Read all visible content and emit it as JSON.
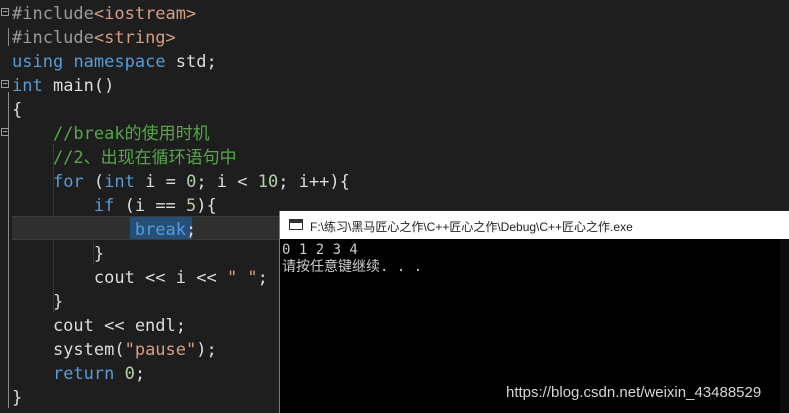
{
  "editor": {
    "lines": [
      [
        {
          "t": "#include",
          "c": "#9b9b9b"
        },
        {
          "t": "<iostream>",
          "c": "#d69d85"
        }
      ],
      [
        {
          "t": "#include",
          "c": "#9b9b9b"
        },
        {
          "t": "<string>",
          "c": "#d69d85"
        }
      ],
      [
        {
          "t": "using",
          "c": "#569cd6"
        },
        {
          "t": " ",
          "c": "#dcdcdc"
        },
        {
          "t": "namespace",
          "c": "#569cd6"
        },
        {
          "t": " std;",
          "c": "#dcdcdc"
        }
      ],
      [
        {
          "t": "int",
          "c": "#569cd6"
        },
        {
          "t": " main()",
          "c": "#dcdcdc"
        }
      ],
      [
        {
          "t": "{",
          "c": "#dcdcdc"
        }
      ],
      [
        {
          "t": "    //break的使用时机",
          "c": "#57a64a"
        }
      ],
      [
        {
          "t": "    //2、出现在循环语句中",
          "c": "#57a64a"
        }
      ],
      [
        {
          "t": "    ",
          "c": "#dcdcdc"
        },
        {
          "t": "for",
          "c": "#569cd6"
        },
        {
          "t": " (",
          "c": "#dcdcdc"
        },
        {
          "t": "int",
          "c": "#569cd6"
        },
        {
          "t": " i = ",
          "c": "#dcdcdc"
        },
        {
          "t": "0",
          "c": "#b5cea8"
        },
        {
          "t": "; i < ",
          "c": "#dcdcdc"
        },
        {
          "t": "10",
          "c": "#b5cea8"
        },
        {
          "t": "; i++){",
          "c": "#dcdcdc"
        }
      ],
      [
        {
          "t": "        ",
          "c": "#dcdcdc"
        },
        {
          "t": "if",
          "c": "#569cd6"
        },
        {
          "t": " (i == ",
          "c": "#dcdcdc"
        },
        {
          "t": "5",
          "c": "#b5cea8"
        },
        {
          "t": "){",
          "c": "#dcdcdc"
        }
      ],
      [
        {
          "t": "            ",
          "c": "#dcdcdc"
        },
        {
          "t": "break",
          "c": "#569cd6"
        },
        {
          "t": ";",
          "c": "#dcdcdc"
        }
      ],
      [
        {
          "t": "        }",
          "c": "#dcdcdc"
        }
      ],
      [
        {
          "t": "        cout << i << ",
          "c": "#dcdcdc"
        },
        {
          "t": "\" \"",
          "c": "#d69d85"
        },
        {
          "t": ";",
          "c": "#dcdcdc"
        }
      ],
      [
        {
          "t": "    }",
          "c": "#dcdcdc"
        }
      ],
      [
        {
          "t": "    cout << endl;",
          "c": "#dcdcdc"
        }
      ],
      [
        {
          "t": "    system(",
          "c": "#dcdcdc"
        },
        {
          "t": "\"pause\"",
          "c": "#d69d85"
        },
        {
          "t": ");",
          "c": "#dcdcdc"
        }
      ],
      [
        {
          "t": "    ",
          "c": "#dcdcdc"
        },
        {
          "t": "return",
          "c": "#569cd6"
        },
        {
          "t": " ",
          "c": "#dcdcdc"
        },
        {
          "t": "0",
          "c": "#b5cea8"
        },
        {
          "t": ";",
          "c": "#dcdcdc"
        }
      ],
      [
        {
          "t": "}",
          "c": "#dcdcdc"
        }
      ]
    ]
  },
  "console": {
    "title": "F:\\练习\\黑马匠心之作\\C++匠心之作\\Debug\\C++匠心之作.exe",
    "output_numbers": "0 1 2 3 4",
    "output_prompt": "请按任意键继续. . ."
  },
  "watermark": "https://blog.csdn.net/weixin_43488529",
  "colors": {
    "editor_bg": "#1e1e1e",
    "keyword": "#569cd6",
    "comment": "#57a64a",
    "string": "#d69d85",
    "number": "#b5cea8",
    "preprocessor": "#9b9b9b",
    "text": "#dcdcdc"
  },
  "icons": [
    "fold-collapse-icon",
    "console-window-icon"
  ]
}
